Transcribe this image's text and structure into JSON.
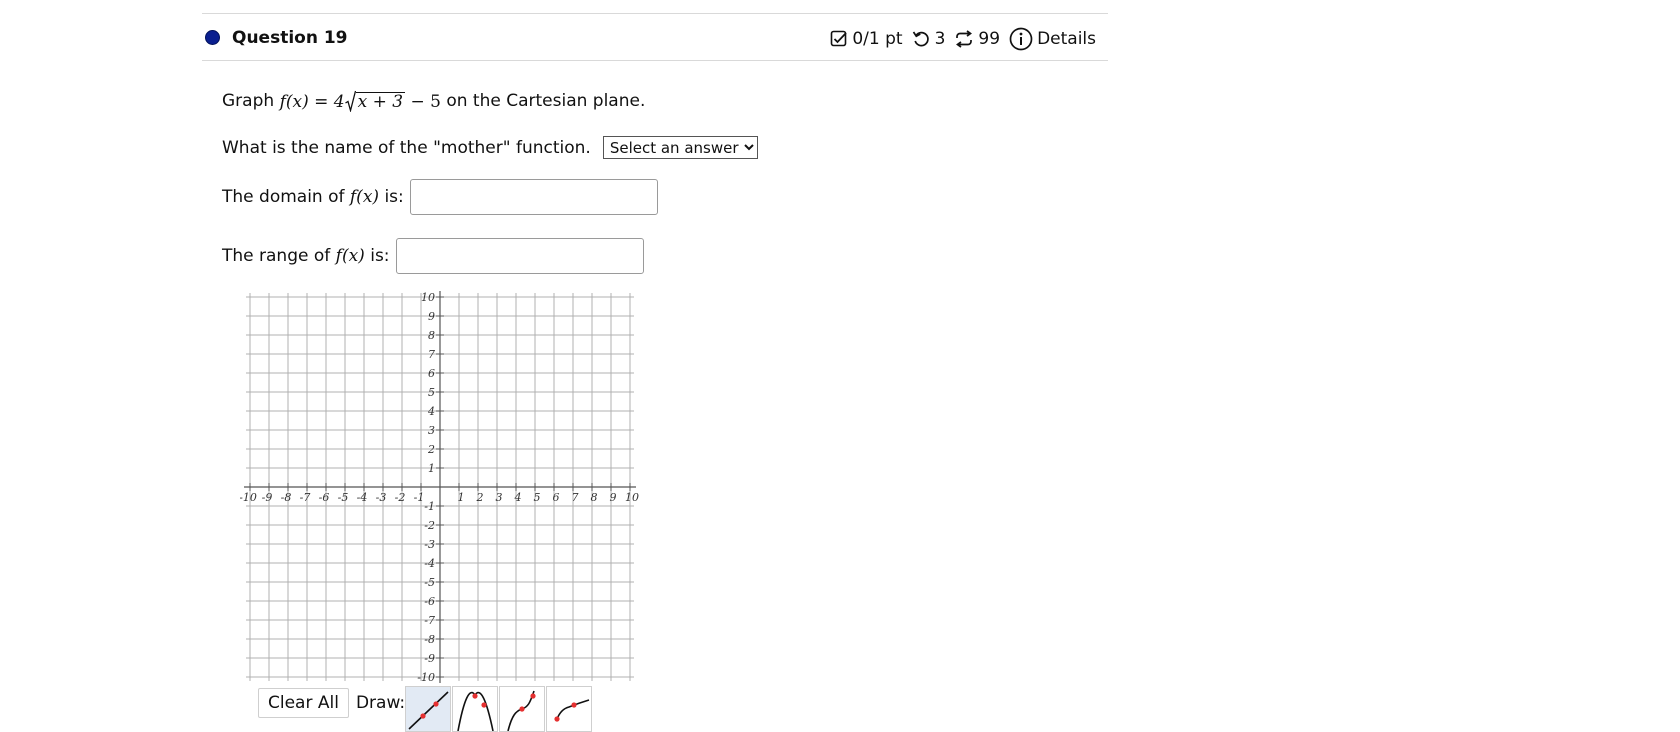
{
  "question": {
    "title": "Question 19",
    "points": "0/1 pt",
    "retries": "3",
    "attempts": "99",
    "details_label": "Details",
    "prompt_prefix": "Graph",
    "prompt_suffix": "on the Cartesian plane.",
    "mother_label": "What is the name of the \"mother\" function.",
    "mother_select": {
      "selected": "Select an answer"
    },
    "domain_prefix": "The domain of",
    "domain_suffix": "is:",
    "range_prefix": "The range of",
    "range_suffix": "is:",
    "func_name": "f(x)",
    "formula": {
      "lhs": "f(x) = 4",
      "radicand": "x + 3",
      "rest": "− 5"
    }
  },
  "colors": {
    "status_dot": "#0a1f8f",
    "grid": "#b0b0b0",
    "axis": "#555555",
    "tool_active": "#e2eaf4",
    "point": "#e53030"
  },
  "chart_data": {
    "type": "scatter",
    "xlim": [
      -10,
      10
    ],
    "ylim": [
      -10,
      10
    ],
    "grid": true,
    "x_ticks": [
      -10,
      -9,
      -8,
      -7,
      -6,
      -5,
      -4,
      -3,
      -2,
      -1,
      1,
      2,
      3,
      4,
      5,
      6,
      7,
      8,
      9,
      10
    ],
    "y_ticks": [
      10,
      9,
      8,
      7,
      6,
      5,
      4,
      3,
      2,
      1,
      -1,
      -2,
      -3,
      -4,
      -5,
      -6,
      -7,
      -8,
      -9,
      -10
    ]
  },
  "toolbar": {
    "clear_label": "Clear All",
    "draw_label": "Draw:",
    "tools": [
      {
        "name": "line-tool-icon",
        "active": true
      },
      {
        "name": "parabola-tool-icon",
        "active": false
      },
      {
        "name": "cubic-tool-icon",
        "active": false
      },
      {
        "name": "sqrt-tool-icon",
        "active": false
      }
    ]
  }
}
